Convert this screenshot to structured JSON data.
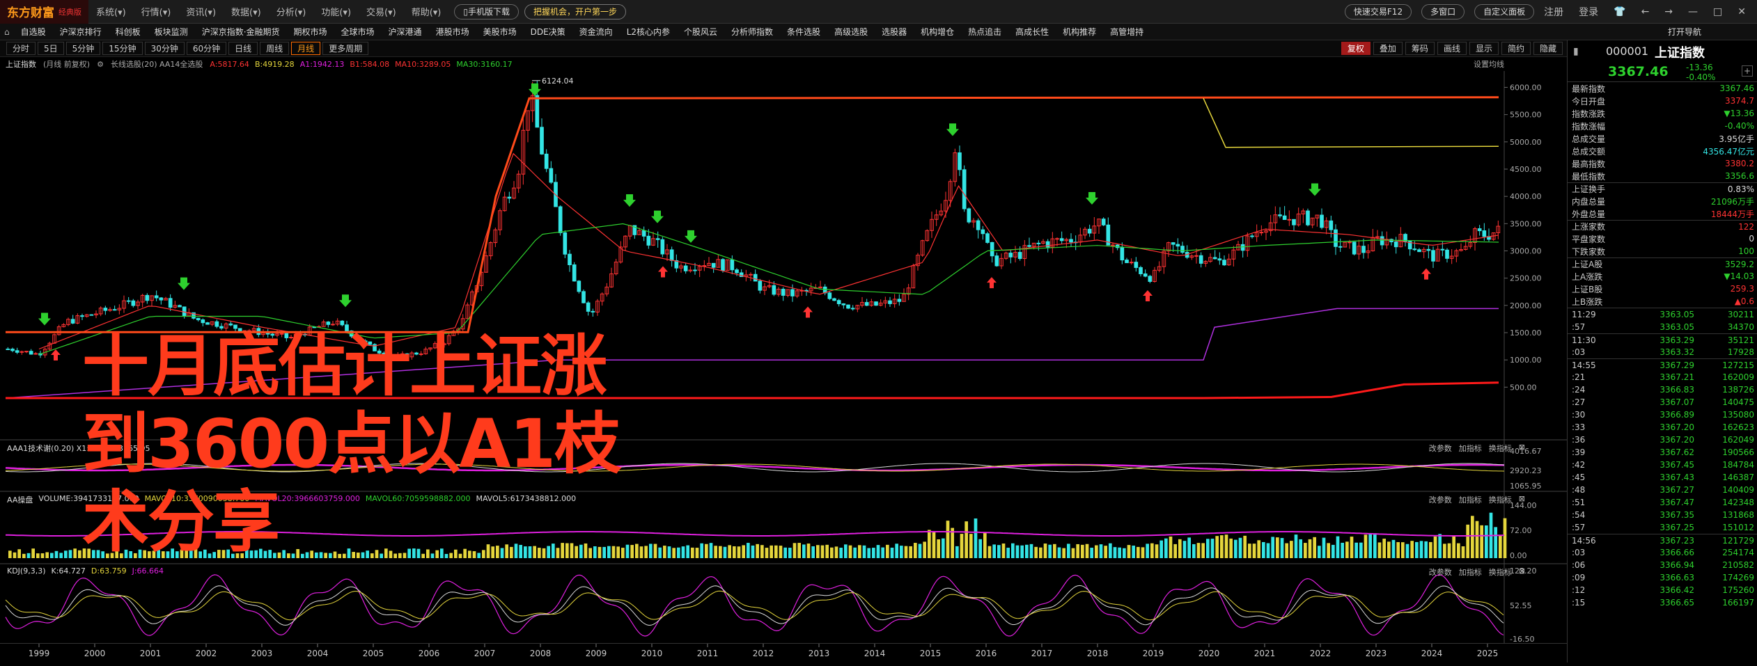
{
  "menubar": {
    "logo": "东方财富",
    "logo_sub": "经典版",
    "items": [
      "系统",
      "行情",
      "资讯",
      "数据",
      "分析",
      "功能",
      "交易",
      "帮助"
    ],
    "btn_mobile": "手机版下载",
    "btn_promo": "把握机会，开户第一步",
    "btn_fast": "快速交易F12",
    "btn_multi": "多窗口",
    "btn_custom": "自定义面板",
    "login": "注册",
    "logout": "登录"
  },
  "navbar": {
    "items": [
      "自选股",
      "沪深京排行",
      "科创板",
      "板块监测",
      "沪深京指数·金融期货",
      "期权市场",
      "全球市场",
      "沪深港通",
      "港股市场",
      "美股市场",
      "DDE决策",
      "资金流向",
      "L2核心内参",
      "个股风云",
      "分析师指数",
      "条件选股",
      "高级选股",
      "选股器",
      "机构增仓",
      "热点追击",
      "高成长性",
      "机构推荐",
      "高管增持"
    ],
    "right": "打开导航"
  },
  "periodbar": {
    "items": [
      "分时",
      "5日",
      "5分钟",
      "15分钟",
      "30分钟",
      "60分钟",
      "日线",
      "周线",
      "月线",
      "更多周期"
    ],
    "active_index": 8,
    "right": [
      "复权",
      "叠加",
      "筹码",
      "画线",
      "显示",
      "简约",
      "隐藏"
    ]
  },
  "infobar": {
    "title": "上证指数",
    "sub": "(月线 前复权)",
    "ind_name": "长线选股(20) AA14全选股",
    "vals": [
      {
        "t": "A:5817.64",
        "c": "r"
      },
      {
        "t": "B:4919.28",
        "c": "y"
      },
      {
        "t": "A1:1942.13",
        "c": "m"
      },
      {
        "t": "B1:584.08",
        "c": "r"
      },
      {
        "t": "MA10:3289.05",
        "c": "r"
      },
      {
        "t": "MA30:3160.17",
        "c": "g"
      }
    ],
    "settings": "设置均线"
  },
  "main_axis": [
    "6000.00",
    "5500.00",
    "5000.00",
    "4500.00",
    "4000.00",
    "3500.00",
    "3000.00",
    "2500.00",
    "2000.00",
    "1500.00",
    "1000.00",
    "500.00"
  ],
  "peak_label": "6124.04",
  "ind1": {
    "label": "AAA1技术谢(0.20)",
    "vals": "X1:3212.2 3165.95",
    "axis": [
      "4016.67",
      "2920.23",
      "1065.95"
    ],
    "btns": [
      "改参数",
      "加指标",
      "换指标"
    ]
  },
  "ind2": {
    "label": "AA操盘",
    "vals": [
      {
        "t": "VOLUME:3941733177.000",
        "c": "w"
      },
      {
        "t": "MAVOL10:3370090058.700",
        "c": "y"
      },
      {
        "t": "MAVOL20:3966603759.000",
        "c": "m"
      },
      {
        "t": "MAVOL60:7059598882.000",
        "c": "g"
      },
      {
        "t": "MAVOL5:6173438812.000",
        "c": "w"
      }
    ],
    "axis": [
      "144.00",
      "72.00",
      "0.00"
    ],
    "btns": [
      "改参数",
      "加指标",
      "换指标"
    ]
  },
  "ind3": {
    "label": "KDJ(9,3,3)",
    "vals": [
      {
        "t": "K:64.727",
        "c": "w"
      },
      {
        "t": "D:63.759",
        "c": "y"
      },
      {
        "t": "J:66.664",
        "c": "m"
      }
    ],
    "axis": [
      "123.20",
      "52.55",
      "-16.50"
    ],
    "btns": [
      "改参数",
      "加指标",
      "换指标"
    ]
  },
  "xaxis": [
    "1999",
    "2000",
    "2001",
    "2002",
    "2003",
    "2004",
    "2005",
    "2006",
    "2007",
    "2008",
    "2009",
    "2010",
    "2011",
    "2012",
    "2013",
    "2014",
    "2015",
    "2016",
    "2017",
    "2018",
    "2019",
    "2020",
    "2021",
    "2022",
    "2023",
    "2024",
    "2025"
  ],
  "overlay": [
    "十月底估计上证涨",
    "到3600点以A1枝",
    "术分享"
  ],
  "right_panel": {
    "code": "000001",
    "name": "上证指数",
    "price": "3367.46",
    "chg": "-13.36",
    "pct": "-0.40%",
    "stats": [
      {
        "k": "最新指数",
        "v": "3367.46",
        "c": "g"
      },
      {
        "k": "今日开盘",
        "v": "3374.7",
        "c": "r"
      },
      {
        "k": "指数涨跌",
        "v": "▼13.36",
        "c": "g"
      },
      {
        "k": "指数涨幅",
        "v": "-0.40%",
        "c": "g"
      },
      {
        "k": "总成交量",
        "v": "3.95亿手",
        "c": "w"
      },
      {
        "k": "总成交额",
        "v": "4356.47亿元",
        "c": "c"
      },
      {
        "k": "最高指数",
        "v": "3380.2",
        "c": "r"
      },
      {
        "k": "最低指数",
        "v": "3356.6",
        "c": "g"
      },
      {
        "k": "上证换手",
        "v": "0.83%",
        "c": "w"
      },
      {
        "k": "内盘总量",
        "v": "21096万手",
        "c": "g"
      },
      {
        "k": "外盘总量",
        "v": "18444万手",
        "c": "r"
      },
      {
        "k": "上涨家数",
        "v": "122",
        "c": "r"
      },
      {
        "k": "平盘家数",
        "v": "0",
        "c": "w"
      },
      {
        "k": "下跌家数",
        "v": "100",
        "c": "g"
      },
      {
        "k": "上证A股",
        "v": "3529.2",
        "c": "g"
      },
      {
        "k": "上A涨跌",
        "v": "▼14.03",
        "c": "g"
      },
      {
        "k": "上证B股",
        "v": "259.3",
        "c": "r"
      },
      {
        "k": "上B涨跌",
        "v": "▲0.6",
        "c": "r"
      }
    ],
    "ticks": [
      {
        "t": "11:29",
        "p": "3363.05",
        "q": "30211"
      },
      {
        "t": ":57",
        "p": "3363.05",
        "q": "34370"
      },
      {
        "t": "11:30",
        "p": "3363.29",
        "q": "35121"
      },
      {
        "t": ":03",
        "p": "3363.32",
        "q": "17928"
      },
      {
        "t": "14:55",
        "p": "3367.29",
        "q": "127215"
      },
      {
        "t": ":21",
        "p": "3367.21",
        "q": "162009"
      },
      {
        "t": ":24",
        "p": "3366.83",
        "q": "138726"
      },
      {
        "t": ":27",
        "p": "3367.07",
        "q": "140475"
      },
      {
        "t": ":30",
        "p": "3366.89",
        "q": "135080"
      },
      {
        "t": ":33",
        "p": "3367.20",
        "q": "162623"
      },
      {
        "t": ":36",
        "p": "3367.20",
        "q": "162049"
      },
      {
        "t": ":39",
        "p": "3367.62",
        "q": "190566"
      },
      {
        "t": ":42",
        "p": "3367.45",
        "q": "184784"
      },
      {
        "t": ":45",
        "p": "3367.43",
        "q": "146387"
      },
      {
        "t": ":48",
        "p": "3367.27",
        "q": "140409"
      },
      {
        "t": ":51",
        "p": "3367.47",
        "q": "142348"
      },
      {
        "t": ":54",
        "p": "3367.35",
        "q": "131868"
      },
      {
        "t": ":57",
        "p": "3367.25",
        "q": "151012"
      },
      {
        "t": "14:56",
        "p": "3367.23",
        "q": "121729"
      },
      {
        "t": ":03",
        "p": "3366.66",
        "q": "254174"
      },
      {
        "t": ":06",
        "p": "3366.94",
        "q": "210582"
      },
      {
        "t": ":09",
        "p": "3366.63",
        "q": "174269"
      },
      {
        "t": ":12",
        "p": "3366.42",
        "q": "175260"
      },
      {
        "t": ":15",
        "p": "3366.65",
        "q": "166197"
      }
    ]
  },
  "colors": {
    "up": "#ff3333",
    "down": "#33e5e5",
    "ma10": "#ff3333",
    "ma30": "#2ed12e",
    "line_a": "#ff4a1a",
    "line_b": "#e5d63c",
    "line_a1": "#b030e0",
    "line_b1": "#ff1a1a",
    "overlay": "#ff3b1c"
  },
  "chart_data": {
    "type": "candlestick",
    "title": "上证指数",
    "period": "monthly",
    "ylim": [
      300,
      6300
    ],
    "x_start_year": 1998.4,
    "x_end_year": 2025.3,
    "series": [
      {
        "name": "close",
        "x": [
          1998.5,
          1999.0,
          1999.4,
          1999.5,
          2000.0,
          2000.5,
          2001.0,
          2001.4,
          2001.8,
          2002.5,
          2003.0,
          2003.5,
          2004.0,
          2004.3,
          2004.8,
          2005.0,
          2005.4,
          2005.9,
          2006.3,
          2006.6,
          2007.0,
          2007.3,
          2007.6,
          2007.8,
          2008.1,
          2008.5,
          2008.9,
          2009.2,
          2009.6,
          2010.0,
          2010.5,
          2011.0,
          2011.5,
          2012.0,
          2012.5,
          2013.0,
          2013.5,
          2014.0,
          2014.5,
          2014.9,
          2015.3,
          2015.45,
          2015.6,
          2015.9,
          2016.1,
          2016.5,
          2017.0,
          2017.5,
          2018.0,
          2018.5,
          2019.0,
          2019.3,
          2019.8,
          2020.2,
          2020.5,
          2021.0,
          2021.5,
          2022.0,
          2022.3,
          2022.8,
          2023.0,
          2023.5,
          2024.0,
          2024.6,
          2024.75,
          2025.0,
          2025.2
        ],
        "y": [
          1200,
          1100,
          1600,
          1700,
          1850,
          2000,
          2200,
          2000,
          1750,
          1600,
          1500,
          1400,
          1600,
          1700,
          1350,
          1200,
          1050,
          1150,
          1350,
          1700,
          2800,
          3800,
          4500,
          5900,
          4500,
          2800,
          1800,
          2400,
          3400,
          3200,
          2700,
          2800,
          2700,
          2300,
          2200,
          2300,
          2000,
          2000,
          2100,
          3200,
          4100,
          5000,
          3700,
          3500,
          2800,
          2900,
          3150,
          3200,
          3500,
          2800,
          2500,
          3100,
          2900,
          2800,
          3000,
          3500,
          3600,
          3600,
          3100,
          3000,
          3200,
          3200,
          2900,
          3000,
          3300,
          3300,
          3367
        ]
      },
      {
        "name": "MA10",
        "x": [
          1999,
          2001,
          2003,
          2005,
          2006.5,
          2007.5,
          2008.3,
          2009.5,
          2011,
          2013,
          2014.9,
          2015.5,
          2016.3,
          2018,
          2019.5,
          2021,
          2022.5,
          2024,
          2025.2
        ],
        "y": [
          1200,
          2000,
          1600,
          1250,
          1600,
          4800,
          4000,
          3000,
          2700,
          2200,
          2800,
          4200,
          3000,
          3200,
          2900,
          3400,
          3300,
          3100,
          3289
        ]
      },
      {
        "name": "MA30",
        "x": [
          1999,
          2001,
          2003,
          2005,
          2006.5,
          2008,
          2009.5,
          2011,
          2013,
          2014.9,
          2016,
          2018,
          2019.5,
          2021,
          2023,
          2025.2
        ],
        "y": [
          1100,
          1800,
          1800,
          1400,
          1500,
          3300,
          3500,
          3000,
          2300,
          2200,
          3000,
          3100,
          3000,
          3100,
          3200,
          3160
        ]
      },
      {
        "name": "A",
        "x": [
          1998.4,
          2006.7,
          2007.2,
          2007.8,
          2025.2
        ],
        "y": [
          1510,
          1510,
          4000,
          5800,
          5817
        ]
      },
      {
        "name": "B",
        "x": [
          2019.9,
          2020.3,
          2025.2
        ],
        "y": [
          5800,
          4900,
          4919
        ]
      },
      {
        "name": "A1",
        "x": [
          1998.4,
          2008.3,
          2019.9,
          2020.1,
          2022.3,
          2025.2
        ],
        "y": [
          300,
          1000,
          1000,
          1600,
          1942,
          1942
        ]
      },
      {
        "name": "B1",
        "x": [
          1998.4,
          2019.9,
          2022.2,
          2023.5,
          2025.2
        ],
        "y": [
          300,
          300,
          320,
          550,
          584
        ]
      }
    ],
    "annotations": [
      "6124.04"
    ]
  }
}
